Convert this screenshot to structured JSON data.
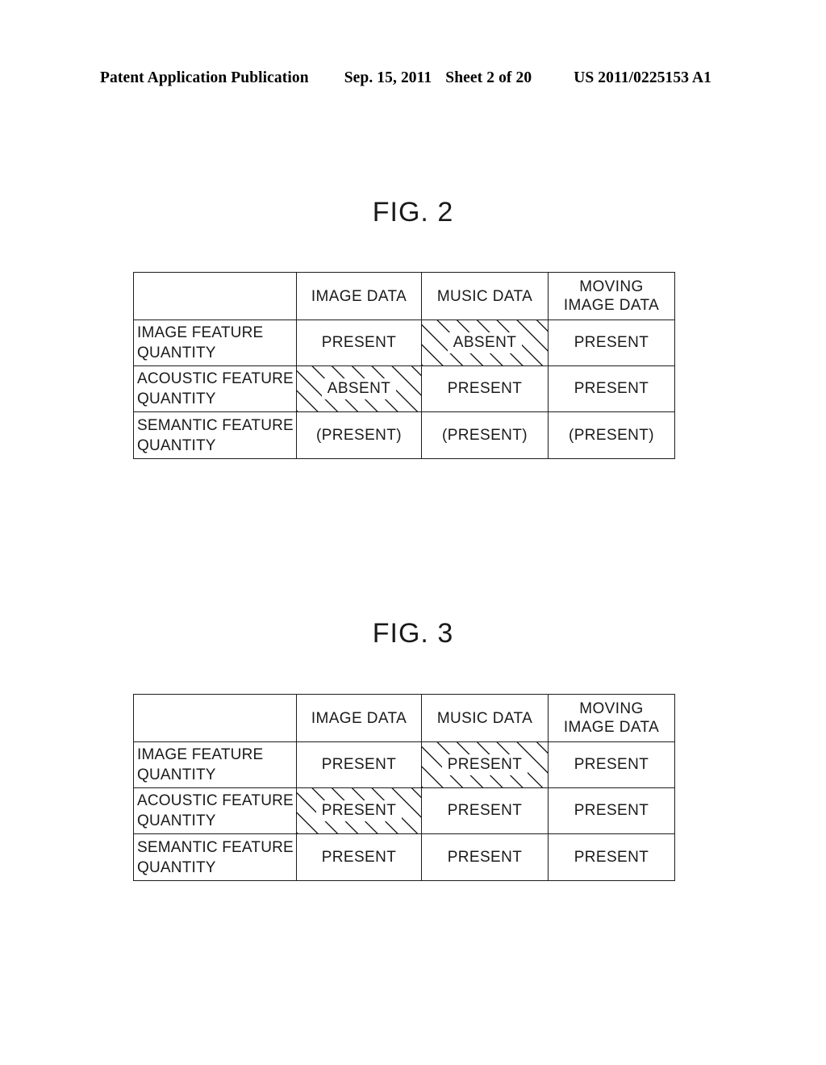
{
  "header": {
    "publication": "Patent Application Publication",
    "date": "Sep. 15, 2011",
    "sheet": "Sheet 2 of 20",
    "document_number": "US 2011/0225153 A1"
  },
  "figures": [
    {
      "title": "FIG. 2",
      "table": {
        "columns": [
          "",
          "IMAGE DATA",
          "MUSIC DATA",
          "MOVING\nIMAGE DATA"
        ],
        "rows": [
          {
            "label": "IMAGE FEATURE\nQUANTITY",
            "cells": [
              {
                "text": "PRESENT",
                "hatched": false
              },
              {
                "text": "ABSENT",
                "hatched": true
              },
              {
                "text": "PRESENT",
                "hatched": false
              }
            ]
          },
          {
            "label": "ACOUSTIC FEATURE\nQUANTITY",
            "cells": [
              {
                "text": "ABSENT",
                "hatched": true
              },
              {
                "text": "PRESENT",
                "hatched": false
              },
              {
                "text": "PRESENT",
                "hatched": false
              }
            ]
          },
          {
            "label": "SEMANTIC FEATURE\nQUANTITY",
            "cells": [
              {
                "text": "(PRESENT)",
                "hatched": false
              },
              {
                "text": "(PRESENT)",
                "hatched": false
              },
              {
                "text": "(PRESENT)",
                "hatched": false
              }
            ]
          }
        ]
      }
    },
    {
      "title": "FIG. 3",
      "table": {
        "columns": [
          "",
          "IMAGE DATA",
          "MUSIC DATA",
          "MOVING\nIMAGE DATA"
        ],
        "rows": [
          {
            "label": "IMAGE FEATURE\nQUANTITY",
            "cells": [
              {
                "text": "PRESENT",
                "hatched": false
              },
              {
                "text": "PRESENT",
                "hatched": true
              },
              {
                "text": "PRESENT",
                "hatched": false
              }
            ]
          },
          {
            "label": "ACOUSTIC FEATURE\nQUANTITY",
            "cells": [
              {
                "text": "PRESENT",
                "hatched": true
              },
              {
                "text": "PRESENT",
                "hatched": false
              },
              {
                "text": "PRESENT",
                "hatched": false
              }
            ]
          },
          {
            "label": "SEMANTIC FEATURE\nQUANTITY",
            "cells": [
              {
                "text": "PRESENT",
                "hatched": false
              },
              {
                "text": "PRESENT",
                "hatched": false
              },
              {
                "text": "PRESENT",
                "hatched": false
              }
            ]
          }
        ]
      }
    }
  ]
}
